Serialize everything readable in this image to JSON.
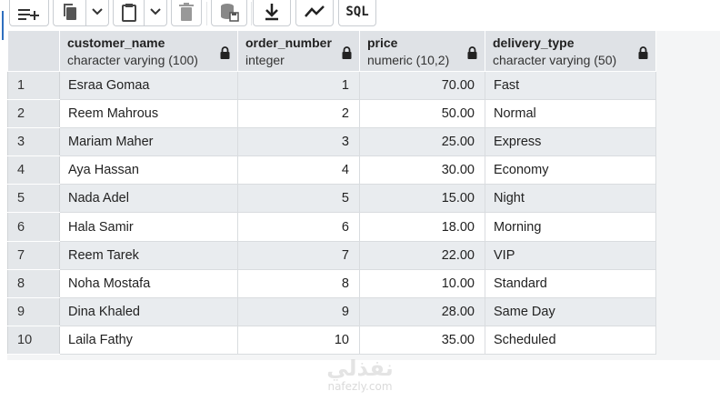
{
  "toolbar": {
    "buttons": [
      {
        "icon": "add-row-icon"
      },
      {
        "icon": "copy-icon"
      },
      {
        "icon": "chevron-down-icon"
      },
      {
        "icon": "paste-icon"
      },
      {
        "icon": "chevron-down-icon"
      },
      {
        "icon": "delete-icon"
      },
      {
        "icon": "save-data-icon"
      },
      {
        "icon": "download-icon"
      },
      {
        "icon": "graph-icon"
      },
      {
        "icon": "sql-icon",
        "label": "SQL"
      }
    ]
  },
  "grid": {
    "columns": [
      {
        "name": "customer_name",
        "type": "character varying (100)",
        "locked": true
      },
      {
        "name": "order_number",
        "type": "integer",
        "locked": true
      },
      {
        "name": "price",
        "type": "numeric (10,2)",
        "locked": true
      },
      {
        "name": "delivery_type",
        "type": "character varying (50)",
        "locked": true
      }
    ],
    "rows": [
      {
        "n": "1",
        "customer_name": "Esraa Gomaa",
        "order_number": "1",
        "price": "70.00",
        "delivery_type": "Fast"
      },
      {
        "n": "2",
        "customer_name": "Reem Mahrous",
        "order_number": "2",
        "price": "50.00",
        "delivery_type": "Normal"
      },
      {
        "n": "3",
        "customer_name": "Mariam Maher",
        "order_number": "3",
        "price": "25.00",
        "delivery_type": "Express"
      },
      {
        "n": "4",
        "customer_name": "Aya Hassan",
        "order_number": "4",
        "price": "30.00",
        "delivery_type": "Economy"
      },
      {
        "n": "5",
        "customer_name": "Nada Adel",
        "order_number": "5",
        "price": "15.00",
        "delivery_type": "Night"
      },
      {
        "n": "6",
        "customer_name": "Hala Samir",
        "order_number": "6",
        "price": "18.00",
        "delivery_type": "Morning"
      },
      {
        "n": "7",
        "customer_name": "Reem Tarek",
        "order_number": "7",
        "price": "22.00",
        "delivery_type": "VIP"
      },
      {
        "n": "8",
        "customer_name": "Noha Mostafa",
        "order_number": "8",
        "price": "10.00",
        "delivery_type": "Standard"
      },
      {
        "n": "9",
        "customer_name": "Dina Khaled",
        "order_number": "9",
        "price": "28.00",
        "delivery_type": "Same Day"
      },
      {
        "n": "10",
        "customer_name": "Laila Fathy",
        "order_number": "10",
        "price": "35.00",
        "delivery_type": "Scheduled"
      }
    ]
  },
  "watermark": {
    "brand": "نفذلي",
    "url": "nafezly.com"
  },
  "colors": {
    "header_bg": "#dfe2e6",
    "stripe_bg": "#e9ecef",
    "accent": "#2f6fbf"
  }
}
